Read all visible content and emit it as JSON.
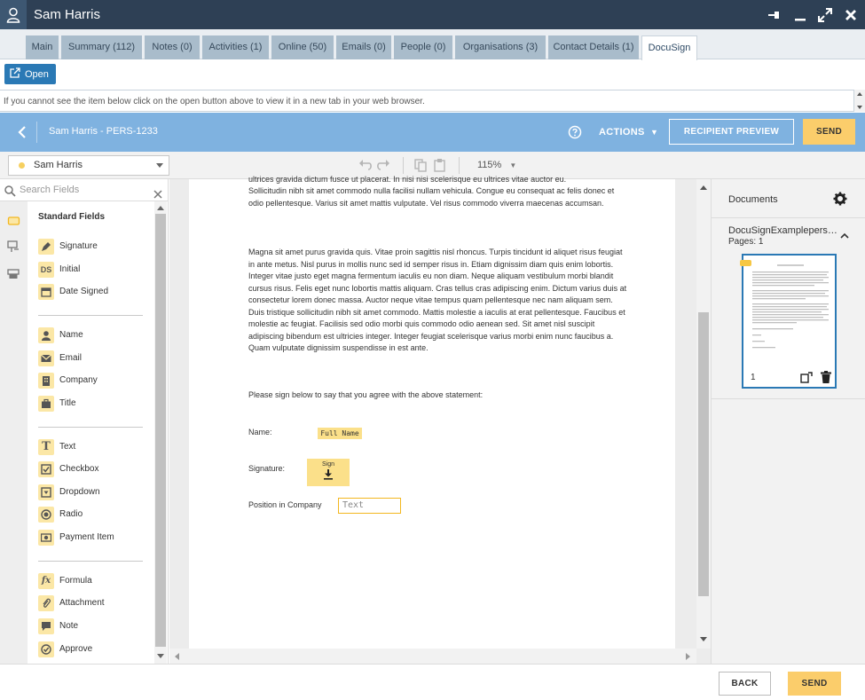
{
  "window": {
    "title": "Sam Harris"
  },
  "tabs": [
    {
      "label": "Main"
    },
    {
      "label": "Summary (112)"
    },
    {
      "label": "Notes (0)"
    },
    {
      "label": "Activities (1)"
    },
    {
      "label": "Online (50)"
    },
    {
      "label": "Emails (0)"
    },
    {
      "label": "People (0)"
    },
    {
      "label": "Organisations (3)"
    },
    {
      "label": "Contact Details (1)"
    },
    {
      "label": "DocuSign"
    }
  ],
  "open_button": {
    "label": "Open"
  },
  "info_text": "If you cannot see the item below click on the open button above to view it in a new tab in your web browser.",
  "docusign": {
    "doc_title": "Sam Harris - PERS-1233",
    "actions_label": "ACTIONS",
    "recipient_preview_label": "RECIPIENT PREVIEW",
    "send_label": "SEND"
  },
  "toolbar": {
    "recipient": "Sam Harris",
    "zoom": "115%"
  },
  "left_panel": {
    "search_placeholder": "Search Fields",
    "group_title": "Standard Fields",
    "groups": [
      [
        {
          "label": "Signature",
          "icon": "pen-icon"
        },
        {
          "label": "Initial",
          "icon": "ds-initial-icon"
        },
        {
          "label": "Date Signed",
          "icon": "calendar-icon"
        }
      ],
      [
        {
          "label": "Name",
          "icon": "person-icon"
        },
        {
          "label": "Email",
          "icon": "envelope-icon"
        },
        {
          "label": "Company",
          "icon": "building-icon"
        },
        {
          "label": "Title",
          "icon": "briefcase-icon"
        }
      ],
      [
        {
          "label": "Text",
          "icon": "text-t-icon"
        },
        {
          "label": "Checkbox",
          "icon": "checkbox-icon"
        },
        {
          "label": "Dropdown",
          "icon": "dropdown-icon"
        },
        {
          "label": "Radio",
          "icon": "radio-icon"
        },
        {
          "label": "Payment Item",
          "icon": "payment-icon"
        }
      ],
      [
        {
          "label": "Formula",
          "icon": "fx-icon"
        },
        {
          "label": "Attachment",
          "icon": "paperclip-icon"
        },
        {
          "label": "Note",
          "icon": "note-icon"
        },
        {
          "label": "Approve",
          "icon": "approve-check-icon"
        }
      ]
    ]
  },
  "document": {
    "paragraph_top_partial": "ultrices gravida dictum fusce ut placerat. In nisi nisi scelerisque eu ultrices vitae auctor eu.",
    "paragraph_1": "Sollicitudin nibh sit amet commodo nulla facilisi nullam vehicula. Congue eu consequat ac felis donec et odio pellentesque. Varius sit amet mattis vulputate. Vel risus commodo viverra maecenas accumsan.",
    "paragraph_2": "Magna sit amet purus gravida quis. Vitae proin sagittis nisl rhoncus. Turpis tincidunt id aliquet risus feugiat in ante metus. Nisl purus in mollis nunc sed id semper risus in. Etiam dignissim diam quis enim lobortis. Integer vitae justo eget magna fermentum iaculis eu non diam. Neque aliquam vestibulum morbi blandit cursus risus. Felis eget nunc lobortis mattis aliquam. Cras tellus cras adipiscing enim. Dictum varius duis at consectetur lorem donec massa. Auctor neque vitae tempus quam pellentesque nec nam aliquam sem. Duis tristique sollicitudin nibh sit amet commodo. Mattis molestie a iaculis at erat pellentesque. Faucibus et molestie ac feugiat. Facilisis sed odio morbi quis commodo odio aenean sed. Sit amet nisl suscipit adipiscing bibendum est ultricies integer. Integer feugiat scelerisque varius morbi enim nunc faucibus a. Quam vulputate dignissim suspendisse in est ante.",
    "sign_prompt": "Please sign below to say that you agree with the above statement:",
    "name_label": "Name:",
    "signature_label": "Signature:",
    "position_label": "Position in Company",
    "full_name_tag": "Full Name",
    "sign_tag": "Sign",
    "text_field": "Text"
  },
  "right_panel": {
    "header": "Documents",
    "doc_name": "DocuSignExamplepers…",
    "pages": "Pages: 1",
    "page_number": "1"
  },
  "footer": {
    "back_label": "BACK",
    "send_label": "SEND"
  },
  "colors": {
    "titlebar": "#2e4055",
    "docusign_header": "#7fb2e0",
    "accent_yellow": "#fbcd6b",
    "open_button": "#2a79b5"
  }
}
